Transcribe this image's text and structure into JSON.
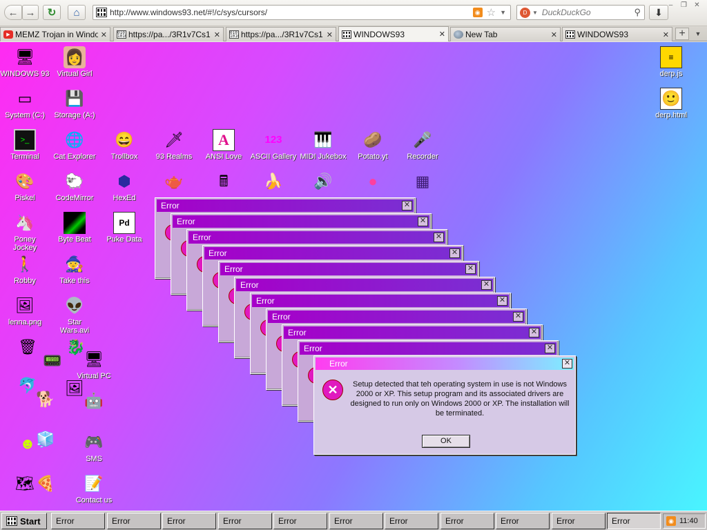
{
  "browser": {
    "url": "http://www.windows93.net/#!/c/sys/cursors/",
    "search_placeholder": "DuckDuckGo",
    "tabs": [
      {
        "label": "MEMZ Trojan in Windo...",
        "icon": "youtube-icon"
      },
      {
        "label": "https://pa.../3R1v7Cs1",
        "icon": "binary-icon"
      },
      {
        "label": "https://pa.../3R1v7Cs1",
        "icon": "binary-icon"
      },
      {
        "label": "WINDOWS93",
        "icon": "windows93-icon",
        "active": true
      },
      {
        "label": "New Tab",
        "icon": "globe-icon"
      },
      {
        "label": "WINDOWS93",
        "icon": "windows93-icon"
      }
    ]
  },
  "desktop": {
    "icons": {
      "windows93": "WINDOWS 93",
      "virtual_girl": "Virtual Girl",
      "system_c": "System (C:)",
      "storage_a": "Storage (A:)",
      "terminal": "Terminal",
      "cat_explorer": "Cat Explorer",
      "trollbox": "Trollbox",
      "realms": "93 Realms",
      "ansi_love": "ANSI Love",
      "ascii_gallery": "ASCII Gallery",
      "midi_jukebox": "MIDI Jukebox",
      "potato": "Potato.yt",
      "recorder": "Recorder",
      "piskel": "Piskel",
      "codemirror": "CodeMirror",
      "hexed": "HexEd",
      "poney": "Poney Jockey",
      "byte_beat": "Byte Beat",
      "puke_data": "Puke Data",
      "robby": "Robby",
      "take_this": "Take this",
      "lenna": "lenna.png",
      "star_wars": "Star Wars.avi",
      "virtual_pc": "Virtual PC",
      "sms": "SMS",
      "contact_us": "Contact us",
      "derp_js": "derp.js",
      "derp_html": "derp.html"
    }
  },
  "errors": {
    "stack_title": "Error",
    "close_glyph": "✕",
    "main_title": "Error",
    "main_message": "Setup detected that teh operating system in use is not Windows 2000 or XP. This setup program and its associated drivers are designed to run only on Windows 2000 or XP. The installation will be terminated.",
    "ok_label": "OK"
  },
  "taskbar": {
    "start_label": "Start",
    "task_label": "Error",
    "clock": "11:40"
  }
}
